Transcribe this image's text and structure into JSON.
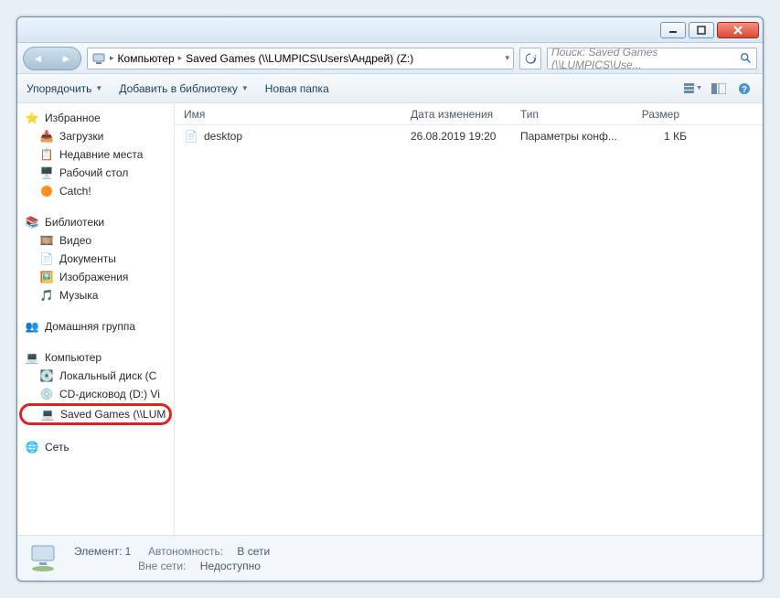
{
  "titlebar": {},
  "breadcrumb": {
    "seg1": "Компьютер",
    "seg2": "Saved Games (\\\\LUMPICS\\Users\\Андрей) (Z:)"
  },
  "search": {
    "placeholder": "Поиск: Saved Games (\\\\LUMPICS\\Use..."
  },
  "toolbar": {
    "organize": "Упорядочить",
    "include": "Добавить в библиотеку",
    "newfolder": "Новая папка"
  },
  "columns": {
    "name": "Имя",
    "date": "Дата изменения",
    "type": "Тип",
    "size": "Размер"
  },
  "files": [
    {
      "name": "desktop",
      "date": "26.08.2019 19:20",
      "type": "Параметры конф...",
      "size": "1 КБ"
    }
  ],
  "sidebar": {
    "favorites": {
      "title": "Избранное",
      "items": [
        "Загрузки",
        "Недавние места",
        "Рабочий стол",
        "Catch!"
      ]
    },
    "libraries": {
      "title": "Библиотеки",
      "items": [
        "Видео",
        "Документы",
        "Изображения",
        "Музыка"
      ]
    },
    "homegroup": {
      "title": "Домашняя группа"
    },
    "computer": {
      "title": "Компьютер",
      "items": [
        "Локальный диск (C",
        "CD-дисковод (D:) Vi",
        "Saved Games (\\\\LUM"
      ]
    },
    "network": {
      "title": "Сеть"
    }
  },
  "status": {
    "elem_label": "Элемент: 1",
    "auton_label": "Автономность:",
    "auton_val": "В сети",
    "offline_label": "Вне сети:",
    "offline_val": "Недоступно"
  }
}
